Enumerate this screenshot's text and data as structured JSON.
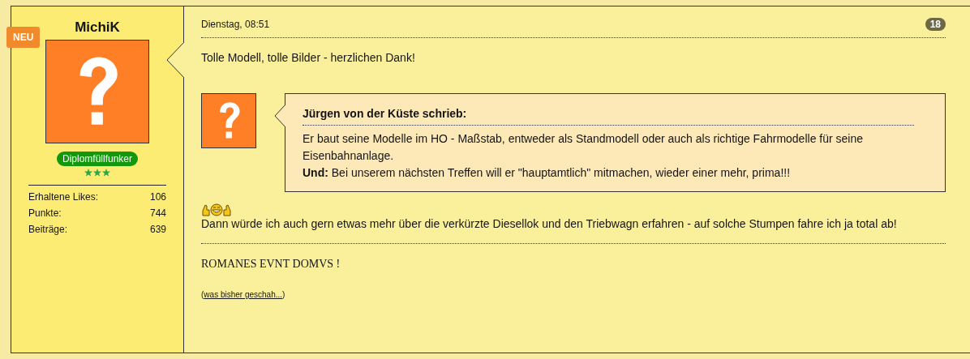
{
  "author": {
    "name": "MichiK",
    "badge": "NEU",
    "rank": "Diplomfüllfunker",
    "stars": 3,
    "stats": [
      {
        "label": "Erhaltene Likes:",
        "value": "106"
      },
      {
        "label": "Punkte:",
        "value": "744"
      },
      {
        "label": "Beiträge:",
        "value": "639"
      }
    ]
  },
  "post": {
    "date": "Dienstag, 08:51",
    "number": "18",
    "intro": "Tolle Modell, tolle Bilder - herzlichen Dank!",
    "quote": {
      "author": "Jürgen von der Küste schrieb:",
      "lines": [
        "Er baut seine Modelle im HO - Maßstab, entweder als Standmodell oder auch als richtige Fahrmodelle für seine Eisenbahnanlage.",
        "**Und:** Bei unserem nächsten Treffen will er \"hauptamtlich\" mitmachen, wieder einer mehr, prima!!!"
      ]
    },
    "reply": "Dann würde ich auch gern etwas mehr über die verkürzte Diesellok und den Triebwagn erfahren - auf solche Stumpen fahre ich ja total ab!",
    "signature": "ROMANES EVNT DOMVS !",
    "signature_link": {
      "before": "(",
      "text": "was bisher geschah...",
      "after": ")"
    }
  }
}
